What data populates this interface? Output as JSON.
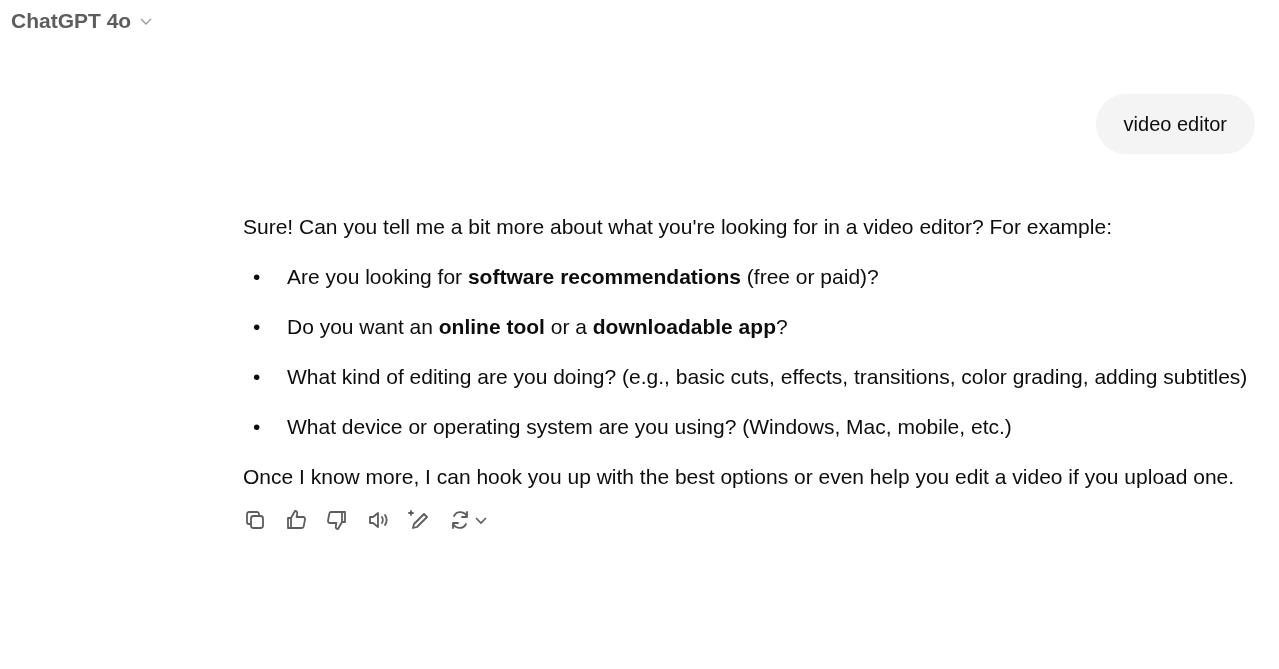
{
  "header": {
    "model_name": "ChatGPT 4o"
  },
  "user_message": {
    "text": "video editor"
  },
  "assistant_message": {
    "intro": "Sure! Can you tell me a bit more about what you're looking for in a video editor? For example:",
    "bullets": [
      {
        "marker": "•",
        "text": "Are you looking for **software recommendations** (free or paid)?"
      },
      {
        "marker": "•",
        "text": "Do you want an **online tool** or a **downloadable app**?"
      },
      {
        "marker": "•",
        "text": "What kind of editing are you doing? (e.g., basic cuts, effects, transitions, color grading, adding subtitles)"
      },
      {
        "marker": "•",
        "text": "What device or operating system are you using? (Windows, Mac, mobile, etc.)"
      }
    ],
    "closing": "Once I know more, I can hook you up with the best options or even help you edit a video if you upload one."
  }
}
